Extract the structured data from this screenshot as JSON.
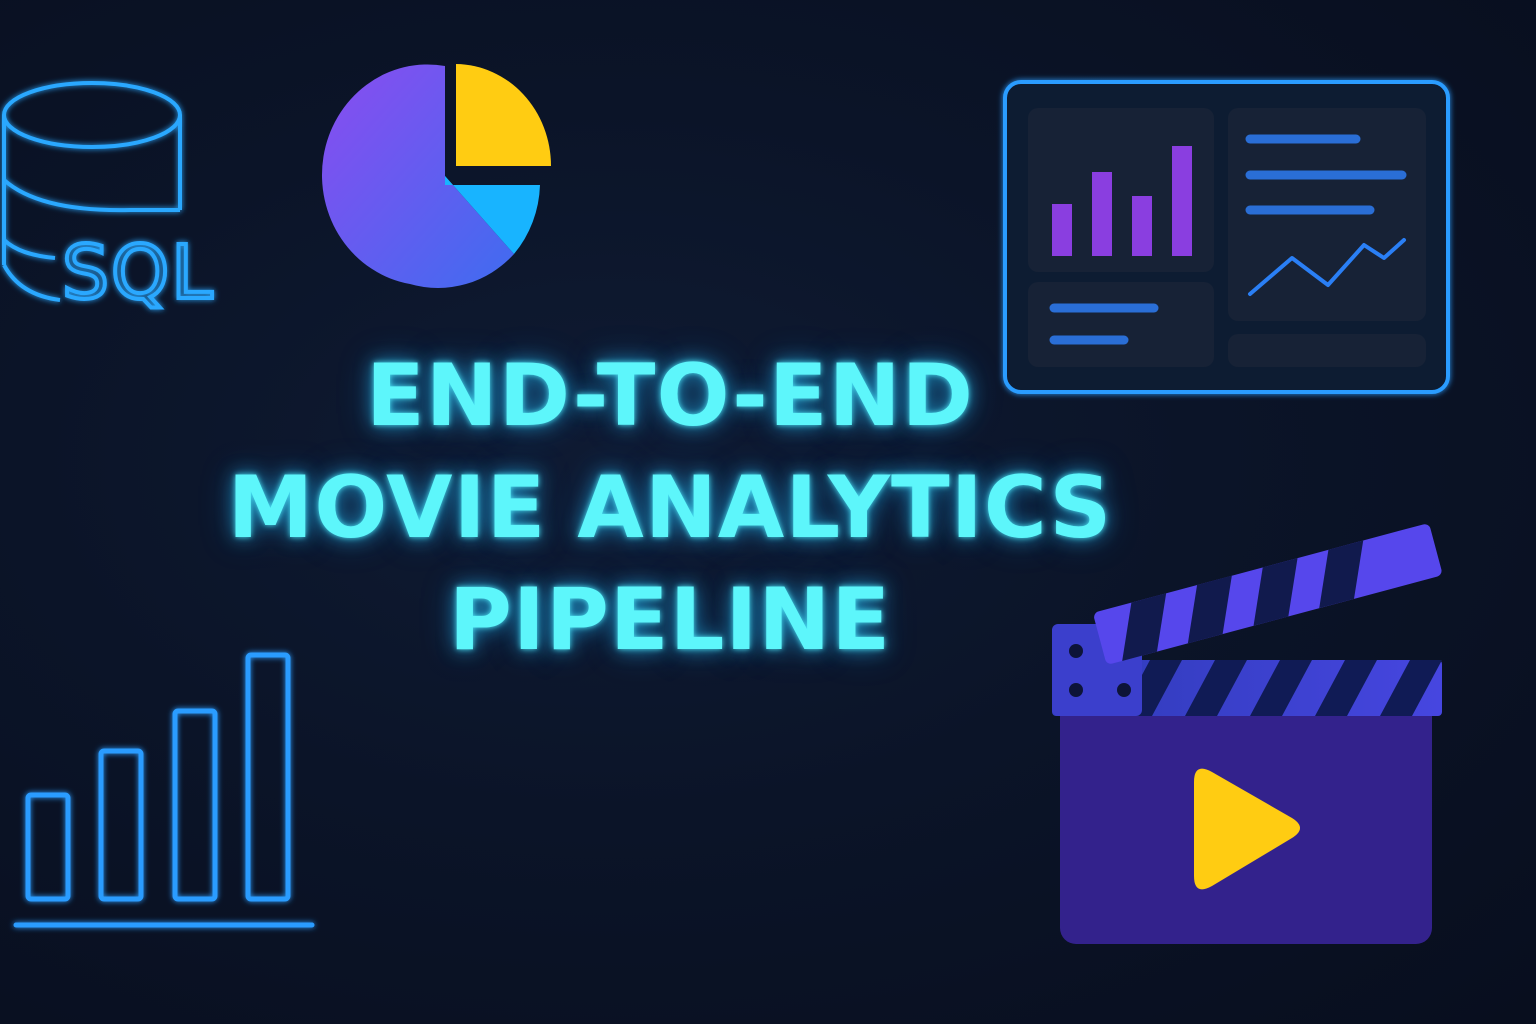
{
  "title": {
    "line1": "END-TO-END",
    "line2": "MOVIE ANALYTICS",
    "line3": "PIPELINE"
  },
  "database_icon": {
    "label": "SQL"
  },
  "icons": {
    "database": "database-icon",
    "pie_chart": "pie-chart-icon",
    "dashboard": "dashboard-icon",
    "bar_chart": "bar-chart-icon",
    "clapperboard": "clapperboard-icon",
    "play": "play-icon"
  },
  "colors": {
    "background": "#0b1428",
    "title_glow": "#5df6fb",
    "outline_blue": "#2aa8ff",
    "purple": "#8a3ee0",
    "yellow": "#ffcc12",
    "cyan": "#18b4ff",
    "clapper_body": "#33228c",
    "clapper_stripe": "#4a4ae6"
  }
}
